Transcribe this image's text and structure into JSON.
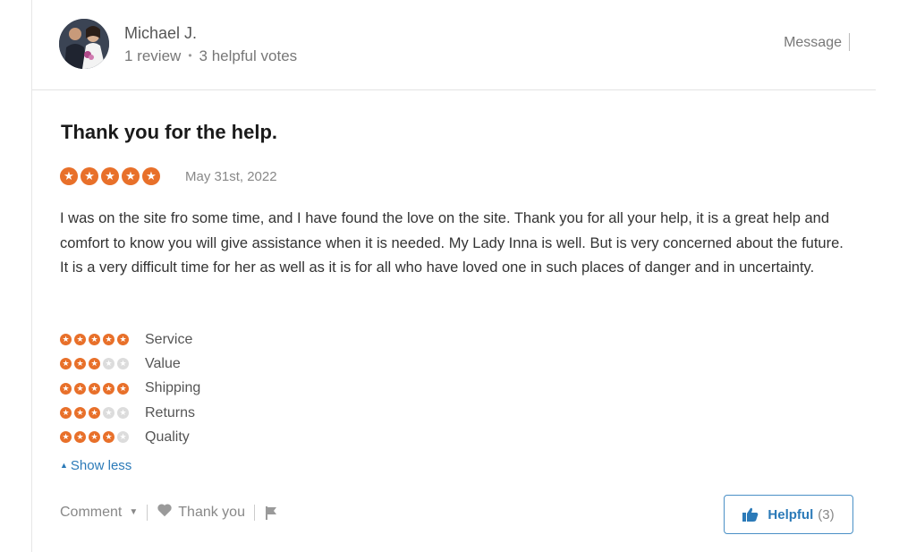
{
  "reviewer": {
    "name": "Michael J.",
    "review_count": "1 review",
    "helpful_votes": "3 helpful votes",
    "message_label": "Message"
  },
  "review": {
    "title": "Thank you for the help.",
    "overall_rating": 5,
    "date": "May 31st, 2022",
    "text": "I was on the site fro some time, and I have found the love on the site. Thank you for all your help, it is a great help and comfort to know you will give assistance when it is needed. My Lady Inna is well. But is very concerned about the future. It is a very difficult time for her as well as it is for all who have loved one in such places of danger and in uncertainty."
  },
  "ratings": [
    {
      "label": "Service",
      "stars": 5
    },
    {
      "label": "Value",
      "stars": 3
    },
    {
      "label": "Shipping",
      "stars": 5
    },
    {
      "label": "Returns",
      "stars": 3
    },
    {
      "label": "Quality",
      "stars": 4
    }
  ],
  "show_less_label": "Show less",
  "footer": {
    "comment_label": "Comment",
    "thank_you_label": "Thank you",
    "helpful_label": "Helpful",
    "helpful_count": "(3)"
  },
  "colors": {
    "star": "#e8702a",
    "link": "#2b7ab8"
  }
}
